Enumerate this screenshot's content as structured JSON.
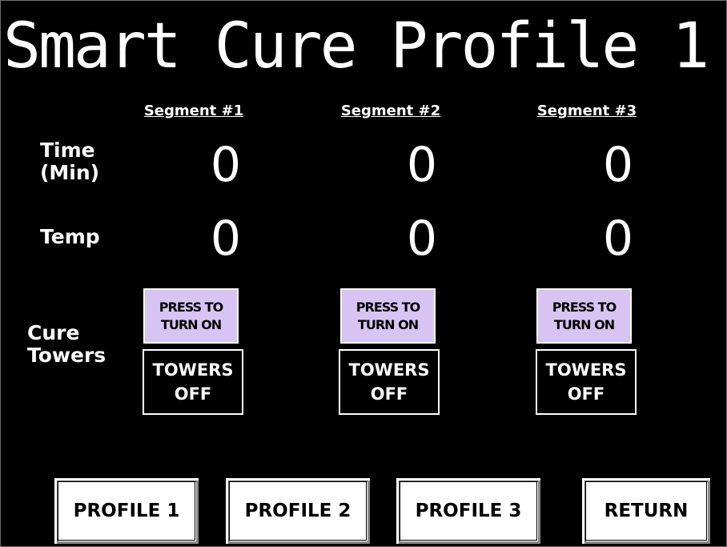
{
  "title": "Smart Cure Profile 1",
  "segments": [
    {
      "header": "Segment #1",
      "time": "0",
      "temp": "0",
      "press_line1": "PRESS TO",
      "press_line2": "TURN ON",
      "status_line1": "TOWERS",
      "status_line2": "OFF"
    },
    {
      "header": "Segment #2",
      "time": "0",
      "temp": "0",
      "press_line1": "PRESS TO",
      "press_line2": "TURN ON",
      "status_line1": "TOWERS",
      "status_line2": "OFF"
    },
    {
      "header": "Segment #3",
      "time": "0",
      "temp": "0",
      "press_line1": "PRESS TO",
      "press_line2": "TURN ON",
      "status_line1": "TOWERS",
      "status_line2": "OFF"
    }
  ],
  "labels": {
    "time_line1": "Time",
    "time_line2": "(Min)",
    "temp": "Temp",
    "cure_line1": "Cure",
    "cure_line2": "Towers"
  },
  "nav": {
    "profile1": "PROFILE 1",
    "profile2": "PROFILE 2",
    "profile3": "PROFILE 3",
    "return": "RETURN"
  },
  "colors": {
    "background": "#000000",
    "press_button": "#d8c4f2",
    "text": "#ffffff"
  }
}
